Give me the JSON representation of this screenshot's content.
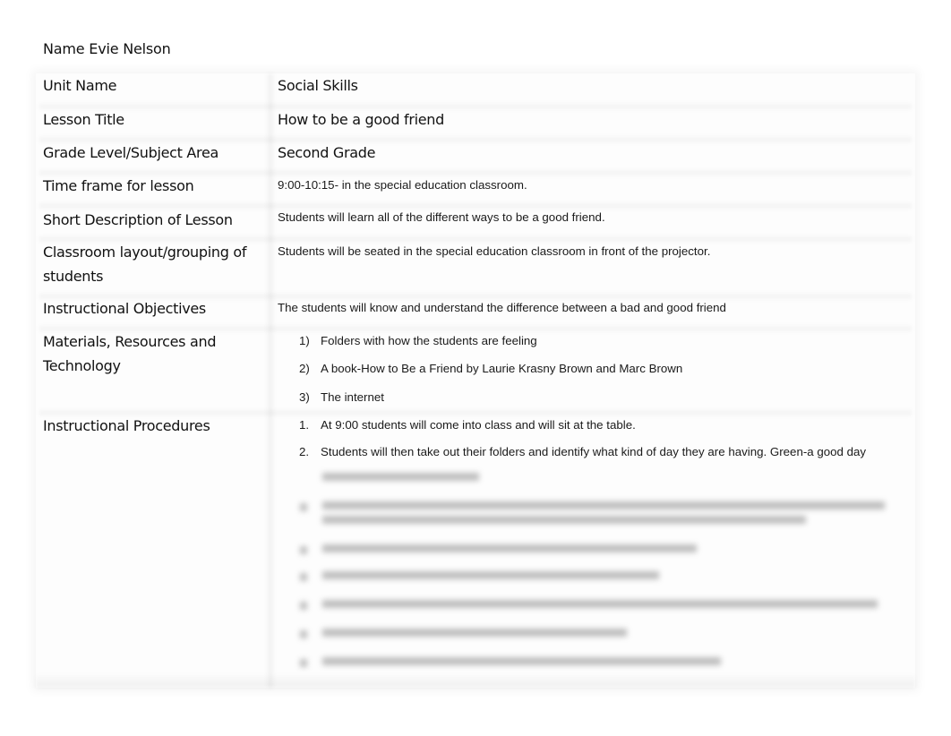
{
  "document": {
    "name_label": "Name",
    "name_value": "Evie Nelson",
    "rows": [
      {
        "label": "Unit Name",
        "value": "Social Skills"
      },
      {
        "label": "Lesson Title",
        "value": "How to be a good friend"
      },
      {
        "label": "Grade Level/Subject Area",
        "value": "Second Grade"
      },
      {
        "label": "Time frame for lesson",
        "value": "9:00-10:15- in the special education classroom."
      },
      {
        "label": "Short Description of Lesson",
        "value": "Students will learn all of the different ways to be a good friend."
      },
      {
        "label": "Classroom layout/grouping of students",
        "value": "Students will be seated in the special education classroom in front of the projector."
      },
      {
        "label": "Instructional Objectives",
        "value": "The students will know and understand the difference between a bad and good friend"
      }
    ],
    "materials": {
      "label": "Materials, Resources and Technology",
      "items": [
        {
          "num": "1)",
          "text": " Folders with how the students are feeling"
        },
        {
          "num": "2)",
          "text": "A book-How to Be a Friend by Laurie Krasny Brown and Marc Brown"
        },
        {
          "num": "3)",
          "text": "The internet"
        }
      ]
    },
    "procedures": {
      "label": "Instructional Procedures",
      "items": [
        {
          "num": "1.",
          "text": "At 9:00  students will come into class and will sit at the table."
        },
        {
          "num": "2.",
          "text": "Students will then take out their folders and identify what kind of day they are having. Green-a good day"
        }
      ],
      "blurred_note": "Content below is blurred (preview obscured)"
    }
  }
}
